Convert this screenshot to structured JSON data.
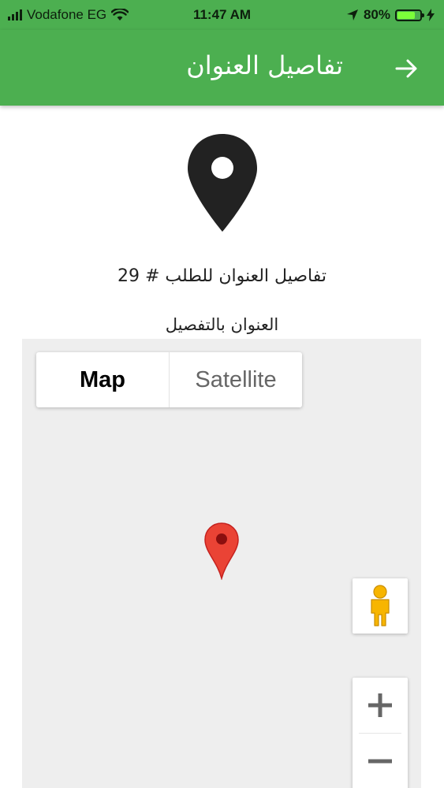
{
  "status_bar": {
    "carrier": "Vodafone EG",
    "time": "11:47 AM",
    "battery_percent": "80%",
    "battery_level": 0.8,
    "icons": [
      "signal-icon",
      "wifi-icon",
      "location-arrow-icon",
      "battery-icon",
      "charging-bolt-icon"
    ]
  },
  "header": {
    "title": "تفاصيل العنوان",
    "back_icon": "arrow-right-icon",
    "color": "#4caf50"
  },
  "content": {
    "pin_icon": "location-pin-icon",
    "order_title": "تفاصيل العنوان للطلب # 29",
    "address_detail": "العنوان بالتفصيل"
  },
  "map": {
    "map_type": {
      "map_label": "Map",
      "satellite_label": "Satellite",
      "selected": "Map"
    },
    "marker_icon": "map-marker-icon",
    "marker_color": "#ea4335",
    "pegman_icon": "pegman-icon",
    "zoom_in_icon": "plus-icon",
    "zoom_out_icon": "minus-icon"
  }
}
